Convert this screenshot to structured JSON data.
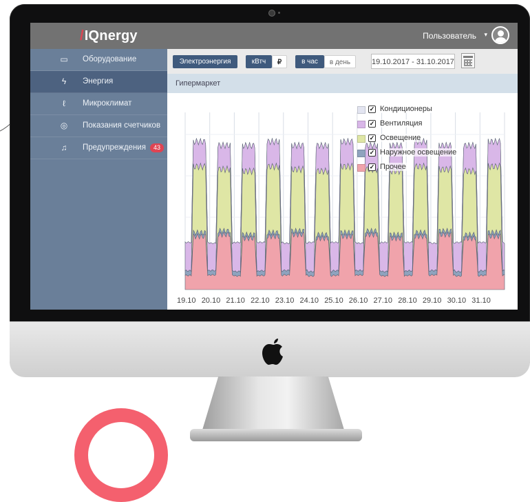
{
  "app": {
    "logo_mark": "/",
    "logo_text": "IQnergy"
  },
  "header": {
    "user_label": "Пользователь",
    "user_caret": "▾",
    "avatar_icon": "user-icon"
  },
  "sidebar": {
    "items": [
      {
        "label": "Оборудование",
        "icon": "monitor-icon",
        "active": false
      },
      {
        "label": "Энергия",
        "icon": "lightning-icon",
        "active": true
      },
      {
        "label": "Микроклимат",
        "icon": "thermometer-icon",
        "active": false
      },
      {
        "label": "Показания счетчиков",
        "icon": "meter-icon",
        "active": false
      },
      {
        "label": "Предупреждения",
        "icon": "bell-icon",
        "active": false,
        "badge": "43"
      }
    ]
  },
  "toolbar": {
    "energy_button": "Электроэнергия",
    "unit_kwh": "кВтч",
    "unit_rub": "₽",
    "per_hour": "в час",
    "per_day": "в день",
    "date_range": "19.10.2017 - 31.10.2017",
    "calendar_icon": "calendar-icon"
  },
  "subheader": {
    "title": "Гипермаркет"
  },
  "colors": {
    "topbar": "#727272",
    "sidebar": "#6a7f99",
    "sidebar_active": "#4d6280",
    "accent": "#3f5a7d",
    "badge": "#e04452",
    "subheader": "#d3dfe9"
  },
  "chart_data": {
    "type": "area",
    "stacked": true,
    "x_tick_labels": [
      "19.10",
      "20.10",
      "21.10",
      "22.10",
      "23.10",
      "24.10",
      "25.10",
      "26.10",
      "27.10",
      "28.10",
      "29.10",
      "30.10",
      "31.10"
    ],
    "legend_position": "top-right",
    "grid": true,
    "series": [
      {
        "name": "Прочее",
        "color": "#f0a3ab",
        "checked": true,
        "day_peak": 0.3,
        "night": 0.08
      },
      {
        "name": "Наружное освещение",
        "color": "#8fa3be",
        "checked": true,
        "day_peak": 0.02,
        "night": 0.025
      },
      {
        "name": "Освещение",
        "color": "#dfe6a5",
        "checked": true,
        "day_peak": 0.36,
        "night": 0.0
      },
      {
        "name": "Вентиляция",
        "color": "#d9b7e8",
        "checked": true,
        "day_peak": 0.14,
        "night": 0.16
      },
      {
        "name": "Кондиционеры",
        "color": "#e3e5f1",
        "checked": true,
        "day_peak": 0.0,
        "night": 0.0
      }
    ],
    "legend_order": [
      "Кондиционеры",
      "Вентиляция",
      "Освещение",
      "Наружное освещение",
      "Прочее"
    ]
  }
}
